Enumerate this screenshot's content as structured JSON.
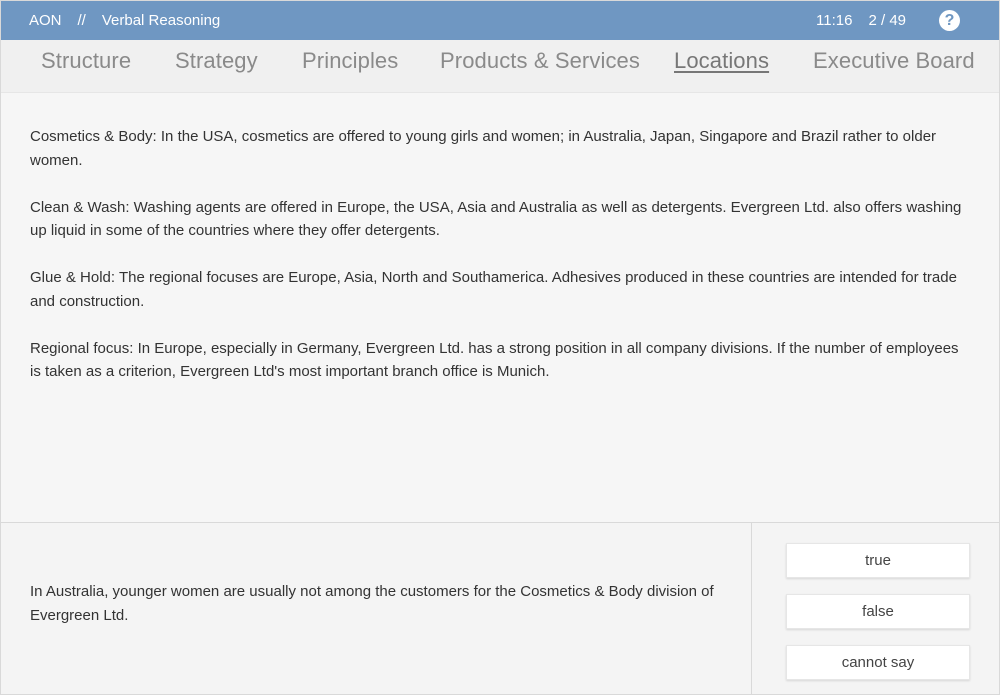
{
  "header": {
    "brand": "AON",
    "separator": "//",
    "section": "Verbal Reasoning",
    "time": "11:16",
    "progress": "2 / 49",
    "help_icon": "?",
    "bar_color": "#6f97c2"
  },
  "tabs": [
    {
      "label": "Structure",
      "active": false
    },
    {
      "label": "Strategy",
      "active": false
    },
    {
      "label": "Principles",
      "active": false
    },
    {
      "label": "Products & Services",
      "active": false
    },
    {
      "label": "Locations",
      "active": true
    },
    {
      "label": "Executive Board",
      "active": false
    }
  ],
  "passage": [
    {
      "term": "Cosmetics & Body:",
      "text": " In the USA, cosmetics are offered to young girls and women; in Australia, Japan, Singapore and Brazil rather to older women."
    },
    {
      "term": "Clean & Wash:",
      "text": " Washing agents are offered in Europe, the USA, Asia and Australia as well as detergents. Evergreen Ltd. also offers washing up liquid in some of the countries where they offer detergents."
    },
    {
      "term": "Glue & Hold:",
      "text": " The regional focuses are Europe, Asia, North and Southamerica. Adhesives produced in these countries are intended for trade and construction."
    },
    {
      "term": "Regional focus:",
      "text": " In Europe, especially in Germany, Evergreen Ltd. has a strong position in all company divisions. If the number of employees is taken as a criterion, Evergreen Ltd's most important branch office is Munich."
    }
  ],
  "question": {
    "statement": "In Australia, younger women are usually not among the customers for the Cosmetics & Body division of Evergreen Ltd.",
    "answers": [
      "true",
      "false",
      "cannot say"
    ]
  }
}
